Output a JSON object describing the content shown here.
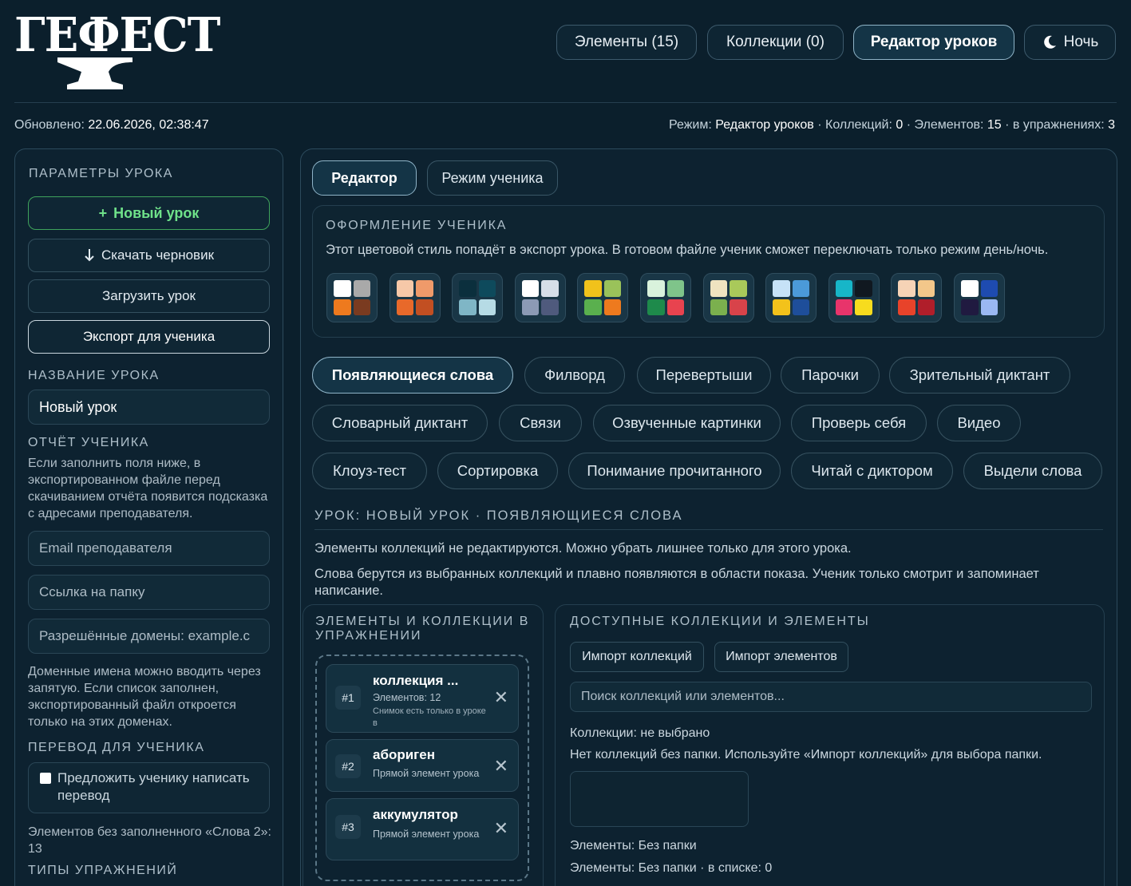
{
  "app": {
    "logo_text": "ГЕФЕСТ"
  },
  "nav": {
    "elements": "Элементы (15)",
    "collections": "Коллекции (0)",
    "lesson_editor": "Редактор уроков",
    "night": "Ночь"
  },
  "status": {
    "updated_label": "Обновлено:",
    "updated_value": "22.06.2026, 02:38:47",
    "mode_label": "Режим:",
    "mode_value": "Редактор уроков",
    "collections_label": "· Коллекций:",
    "collections_value": "0",
    "elements_label": "· Элементов:",
    "elements_value": "15",
    "in_exercises_label": "· в упражнениях:",
    "in_exercises_value": "3"
  },
  "left": {
    "params_title": "ПАРАМЕТРЫ УРОКА",
    "new_lesson": "Новый урок",
    "download_draft": "Скачать черновик",
    "load_lesson": "Загрузить урок",
    "export_student": "Экспорт для ученика",
    "name_title": "НАЗВАНИЕ УРОКА",
    "name_value": "Новый урок",
    "report_title": "ОТЧЁТ УЧЕНИКА",
    "report_text": "Если заполнить поля ниже, в экспортированном файле перед скачиванием отчёта появится подсказка с адресами преподавателя.",
    "email_placeholder": "Email преподавателя",
    "folder_placeholder": "Ссылка на папку",
    "domains_placeholder": "Разрешённые домены: example.c",
    "domains_text": "Доменные имена можно вводить через запятую. Если список заполнен, экспортированный файл откроется только на этих доменах.",
    "translation_title": "ПЕРЕВОД ДЛЯ УЧЕНИКА",
    "translation_checkbox": "Предложить ученику написать перевод",
    "missing_text": "Элементов без заполненного «Слова 2»: 13",
    "types_title": "ТИПЫ УПРАЖНЕНИЙ"
  },
  "main": {
    "tabs": [
      "Редактор",
      "Режим ученика"
    ],
    "theme_title": "ОФОРМЛЕНИЕ УЧЕНИКА",
    "theme_desc": "Этот цветовой стиль попадёт в экспорт урока. В готовом файле ученик сможет переключать только режим день/ночь.",
    "swatches": [
      [
        "#ffffff",
        "#a9a9a9",
        "#ee7a1e",
        "#7a3b20"
      ],
      [
        "#f6c8a8",
        "#ef9a6a",
        "#e8692a",
        "#c24f22"
      ],
      [
        "#0b2f3d",
        "#0e4a5c",
        "#7fb6c6",
        "#b6dbe5"
      ],
      [
        "#ffffff",
        "#d6dfe8",
        "#8c9ab5",
        "#4f5a7d"
      ],
      [
        "#f1c21b",
        "#9ac25a",
        "#5ab04e",
        "#ee7a1e"
      ],
      [
        "#d9f2dc",
        "#7fc48a",
        "#1e8a4b",
        "#e8434f"
      ],
      [
        "#efe3c0",
        "#a9c95a",
        "#7bb04e",
        "#d8434a"
      ],
      [
        "#c6e2f7",
        "#4b9ad8",
        "#f3c21b",
        "#1e4e9a"
      ],
      [
        "#17b6c8",
        "#101820",
        "#e8346b",
        "#f7dc1e"
      ],
      [
        "#f6d3b6",
        "#f3c78a",
        "#e8432a",
        "#b01e2a"
      ],
      [
        "#ffffff",
        "#1e4bb0",
        "#201a40",
        "#9ab8f2"
      ]
    ],
    "exercise_types": [
      "Появляющиеся слова",
      "Филворд",
      "Перевертыши",
      "Парочки",
      "Зрительный диктант",
      "Словарный диктант",
      "Связи",
      "Озвученные картинки",
      "Проверь себя",
      "Видео",
      "Клоуз-тест",
      "Сортировка",
      "Понимание прочитанного",
      "Читай с диктором",
      "Выдели слова"
    ],
    "lesson_head": "УРОК: НОВЫЙ УРОК · ПОЯВЛЯЮЩИЕСЯ СЛОВА",
    "note1": "Элементы коллекций не редактируются. Можно убрать лишнее только для этого урока.",
    "note2": "Слова берутся из выбранных коллекций и плавно появляются в области показа. Ученик только смотрит и запоминает написание.",
    "in_exercise_title": "ЭЛЕМЕНТЫ И КОЛЛЕКЦИИ В УПРАЖНЕНИИ",
    "items": [
      {
        "num": "#1",
        "title": "коллекция ...",
        "sub": "Элементов: 12",
        "small": "Снимок есть только в уроке в"
      },
      {
        "num": "#2",
        "title": "абориген",
        "sub": "Прямой элемент урока"
      },
      {
        "num": "#3",
        "title": "аккумулятор",
        "sub": "Прямой элемент урока"
      }
    ],
    "available_title": "ДОСТУПНЫЕ КОЛЛЕКЦИИ И ЭЛЕМЕНТЫ",
    "import_collections": "Импорт коллекций",
    "import_elements": "Импорт элементов",
    "search_placeholder": "Поиск коллекций или элементов...",
    "collections_none": "Коллекции: не выбрано",
    "collections_hint": "Нет коллекций без папки. Используйте «Импорт коллекций» для выбора папки.",
    "elements_nofolder": "Элементы: Без папки",
    "elements_count": "Элементы: Без папки · в списке: 0"
  }
}
